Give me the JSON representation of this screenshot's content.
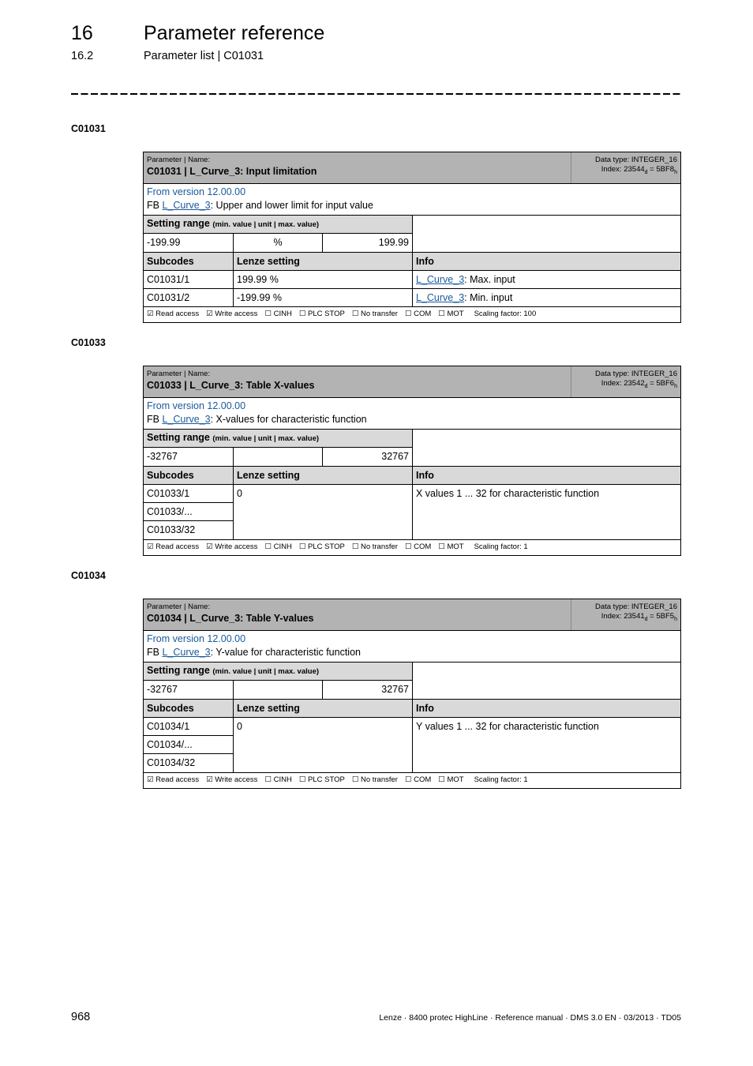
{
  "header": {
    "chapter_number": "16",
    "chapter_title": "Parameter reference",
    "section_number": "16.2",
    "section_title": "Parameter list | C01031"
  },
  "parameters": [
    {
      "heading": "C01031",
      "label": "Parameter | Name:",
      "name": "C01031 | L_Curve_3: Input limitation",
      "data_type": "Data type: INTEGER_16",
      "index_prefix": "Index: ",
      "index_dec": "23544",
      "index_dec_sub": "d",
      "index_eq": " = ",
      "index_hex": "5BF8",
      "index_hex_sub": "h",
      "version": "From version 12.00.00",
      "desc_prefix": "FB ",
      "desc_link": "L_Curve_3",
      "desc_text": ": Upper and lower limit for input value",
      "range_label": "Setting range",
      "range_hint": "(min. value | unit | max. value)",
      "range_min": "-199.99",
      "range_unit": "%",
      "range_max": "199.99",
      "col_subcodes": "Subcodes",
      "col_lenze": "Lenze setting",
      "col_info": "Info",
      "subcodes": [
        {
          "code": "C01031/1",
          "setting": "199.99 %",
          "info_link": "L_Curve_3",
          "info_text": ": Max. input"
        },
        {
          "code": "C01031/2",
          "setting": "-199.99 %",
          "info_link": "L_Curve_3",
          "info_text": ": Min. input"
        }
      ],
      "flags": [
        "☑ Read access",
        "☑ Write access",
        "☐ CINH",
        "☐ PLC STOP",
        "☐ No transfer",
        "☐ COM",
        "☐ MOT"
      ],
      "scaling": "Scaling factor: 100"
    },
    {
      "heading": "C01033",
      "label": "Parameter | Name:",
      "name": "C01033 | L_Curve_3: Table X-values",
      "data_type": "Data type: INTEGER_16",
      "index_prefix": "Index: ",
      "index_dec": "23542",
      "index_dec_sub": "d",
      "index_eq": " = ",
      "index_hex": "5BF6",
      "index_hex_sub": "h",
      "version": "From version 12.00.00",
      "desc_prefix": "FB ",
      "desc_link": "L_Curve_3",
      "desc_text": ": X-values for characteristic function",
      "range_label": "Setting range",
      "range_hint": "(min. value | unit | max. value)",
      "range_min": "-32767",
      "range_unit": "",
      "range_max": "32767",
      "col_subcodes": "Subcodes",
      "col_lenze": "Lenze setting",
      "col_info": "Info",
      "subcodes": [
        {
          "code": "C01033/1"
        },
        {
          "code": "C01033/..."
        },
        {
          "code": "C01033/32"
        }
      ],
      "merged_setting": "0",
      "merged_info": "X values 1 ... 32 for characteristic function",
      "flags": [
        "☑ Read access",
        "☑ Write access",
        "☐ CINH",
        "☐ PLC STOP",
        "☐ No transfer",
        "☐ COM",
        "☐ MOT"
      ],
      "scaling": "Scaling factor: 1"
    },
    {
      "heading": "C01034",
      "label": "Parameter | Name:",
      "name": "C01034 | L_Curve_3: Table Y-values",
      "data_type": "Data type: INTEGER_16",
      "index_prefix": "Index: ",
      "index_dec": "23541",
      "index_dec_sub": "d",
      "index_eq": " = ",
      "index_hex": "5BF5",
      "index_hex_sub": "h",
      "version": "From version 12.00.00",
      "desc_prefix": "FB ",
      "desc_link": "L_Curve_3",
      "desc_text": ": Y-value for characteristic function",
      "range_label": "Setting range",
      "range_hint": "(min. value | unit | max. value)",
      "range_min": "-32767",
      "range_unit": "",
      "range_max": "32767",
      "col_subcodes": "Subcodes",
      "col_lenze": "Lenze setting",
      "col_info": "Info",
      "subcodes": [
        {
          "code": "C01034/1"
        },
        {
          "code": "C01034/..."
        },
        {
          "code": "C01034/32"
        }
      ],
      "merged_setting": "0",
      "merged_info": "Y values 1 ... 32 for characteristic function",
      "flags": [
        "☑ Read access",
        "☑ Write access",
        "☐ CINH",
        "☐ PLC STOP",
        "☐ No transfer",
        "☐ COM",
        "☐ MOT"
      ],
      "scaling": "Scaling factor: 1"
    }
  ],
  "footer": {
    "page_number": "968",
    "doc_info": "Lenze · 8400 protec HighLine · Reference manual · DMS 3.0 EN · 03/2013 · TD05"
  }
}
